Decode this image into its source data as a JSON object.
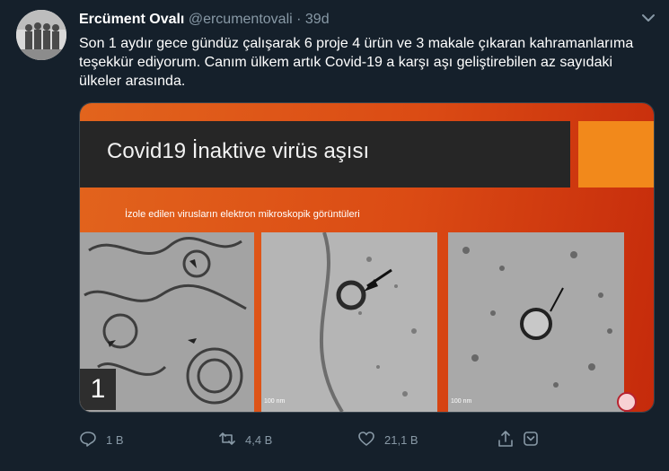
{
  "tweet": {
    "author_name": "Ercüment Ovalı",
    "handle": "@ercumentovali",
    "separator": "·",
    "time": "39d",
    "text": "Son 1 aydır gece gündüz çalışarak 6 proje 4 ürün ve 3 makale çıkaran kahramanlarıma teşekkür ediyorum. Canım ülkem artık Covid-19 a karşı aşı geliştirebilen az sayıdaki ülkeler arasında."
  },
  "media": {
    "slide_title": "Covid19 İnaktive virüs aşısı",
    "slide_subtitle": "İzole edilen virusların elektron mikroskopik görüntüleri",
    "slide_number": "1",
    "scale_bar_label": "100 nm"
  },
  "actions": {
    "reply_count": "1 B",
    "retweet_count": "4,4 B",
    "like_count": "21,1 B"
  },
  "icons": {
    "caret": "chevron-down-icon",
    "reply": "reply-icon",
    "retweet": "retweet-icon",
    "like": "heart-icon",
    "share": "share-icon",
    "save": "bookmark-icon"
  },
  "colors": {
    "background": "#15202b",
    "secondary_text": "#8899a6",
    "slide_orange": "#e2641d",
    "slide_dark": "#262626"
  }
}
